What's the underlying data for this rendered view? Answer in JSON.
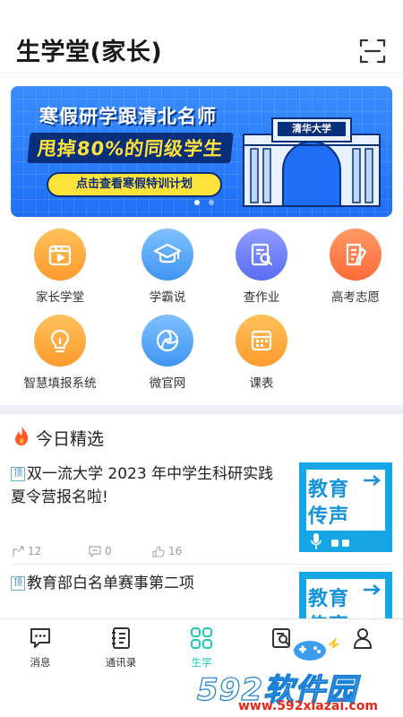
{
  "header": {
    "title": "生学堂(家长)",
    "scan_icon": "scan-icon"
  },
  "banner": {
    "line1": "寒假研学跟清北名师",
    "line2": "甩掉80%的同级学生",
    "cta": "点击查看寒假特训计划",
    "gate_sign": "清华大学",
    "bg_color": "#1e6ff5",
    "highlight_color": "#ffe23a"
  },
  "grid": {
    "items": [
      {
        "label": "家长学堂",
        "icon": "video-icon",
        "color": "#ffa23a"
      },
      {
        "label": "学霸说",
        "icon": "graduation-cap-icon",
        "color": "#4ba3f5"
      },
      {
        "label": "查作业",
        "icon": "homework-search-icon",
        "color": "#6c7cf0"
      },
      {
        "label": "高考志愿",
        "icon": "document-pen-icon",
        "color": "#ff7a45"
      },
      {
        "label": "智慧填报系统",
        "icon": "lightbulb-icon",
        "color": "#ffa23a"
      },
      {
        "label": "微官网",
        "icon": "aperture-icon",
        "color": "#4ba3f5"
      },
      {
        "label": "课表",
        "icon": "calendar-icon",
        "color": "#ffa23a"
      }
    ]
  },
  "section": {
    "title": "今日精选",
    "icon": "fire-icon"
  },
  "news": [
    {
      "tag": "顶",
      "headline": "双一流大学 2023 年中学生科研实践夏令营报名啦!",
      "thumb_text1": "教育",
      "thumb_text2": "传声",
      "shares": "12",
      "comments": "0",
      "likes": "16"
    },
    {
      "tag": "顶",
      "headline": "教育部白名单赛事第二项",
      "thumb_text1": "教育",
      "thumb_text2": "传声"
    }
  ],
  "tabbar": {
    "active_color": "#20c9b3",
    "tabs": [
      {
        "label": "消息",
        "icon": "chat-icon"
      },
      {
        "label": "通讯录",
        "icon": "contacts-icon"
      },
      {
        "label": "生学",
        "icon": "apps-grid-icon"
      },
      {
        "label": "",
        "icon": "discover-icon"
      },
      {
        "label": "",
        "icon": "user-icon"
      }
    ]
  },
  "watermark": {
    "big": "592软件园",
    "small": "www.592xiazai.com"
  }
}
